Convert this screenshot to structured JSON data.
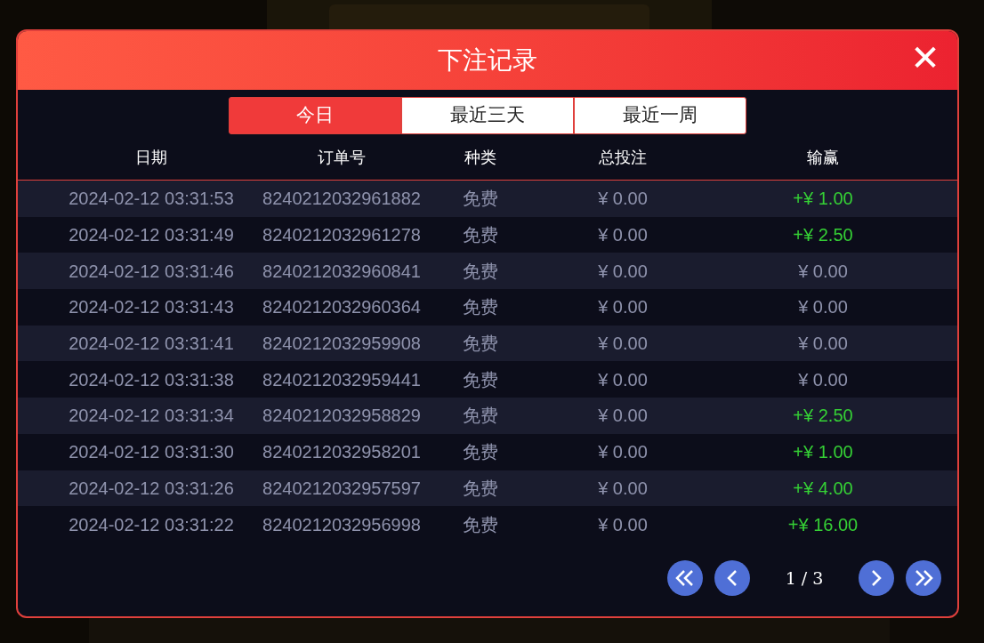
{
  "dialog": {
    "title": "下注记录",
    "close": "✕"
  },
  "tabs": [
    {
      "label": "今日",
      "selected": true
    },
    {
      "label": "最近三天",
      "selected": false
    },
    {
      "label": "最近一周",
      "selected": false
    }
  ],
  "table": {
    "columns": [
      "日期",
      "订单号",
      "种类",
      "总投注",
      "输赢"
    ],
    "rows": [
      {
        "date": "2024-02-12 03:31:53",
        "order": "8240212032961882",
        "type": "免费",
        "bet": "¥ 0.00",
        "result": "+¥ 1.00",
        "kind": "win"
      },
      {
        "date": "2024-02-12 03:31:49",
        "order": "8240212032961278",
        "type": "免费",
        "bet": "¥ 0.00",
        "result": "+¥ 2.50",
        "kind": "win"
      },
      {
        "date": "2024-02-12 03:31:46",
        "order": "8240212032960841",
        "type": "免费",
        "bet": "¥ 0.00",
        "result": "¥ 0.00",
        "kind": "even"
      },
      {
        "date": "2024-02-12 03:31:43",
        "order": "8240212032960364",
        "type": "免费",
        "bet": "¥ 0.00",
        "result": "¥ 0.00",
        "kind": "even"
      },
      {
        "date": "2024-02-12 03:31:41",
        "order": "8240212032959908",
        "type": "免费",
        "bet": "¥ 0.00",
        "result": "¥ 0.00",
        "kind": "even"
      },
      {
        "date": "2024-02-12 03:31:38",
        "order": "8240212032959441",
        "type": "免费",
        "bet": "¥ 0.00",
        "result": "¥ 0.00",
        "kind": "even"
      },
      {
        "date": "2024-02-12 03:31:34",
        "order": "8240212032958829",
        "type": "免费",
        "bet": "¥ 0.00",
        "result": "+¥ 2.50",
        "kind": "win"
      },
      {
        "date": "2024-02-12 03:31:30",
        "order": "8240212032958201",
        "type": "免费",
        "bet": "¥ 0.00",
        "result": "+¥ 1.00",
        "kind": "win"
      },
      {
        "date": "2024-02-12 03:31:26",
        "order": "8240212032957597",
        "type": "免费",
        "bet": "¥ 0.00",
        "result": "+¥ 4.00",
        "kind": "win"
      },
      {
        "date": "2024-02-12 03:31:22",
        "order": "8240212032956998",
        "type": "免费",
        "bet": "¥ 0.00",
        "result": "+¥ 16.00",
        "kind": "win"
      }
    ]
  },
  "pagination": {
    "page": "1 / 3"
  }
}
